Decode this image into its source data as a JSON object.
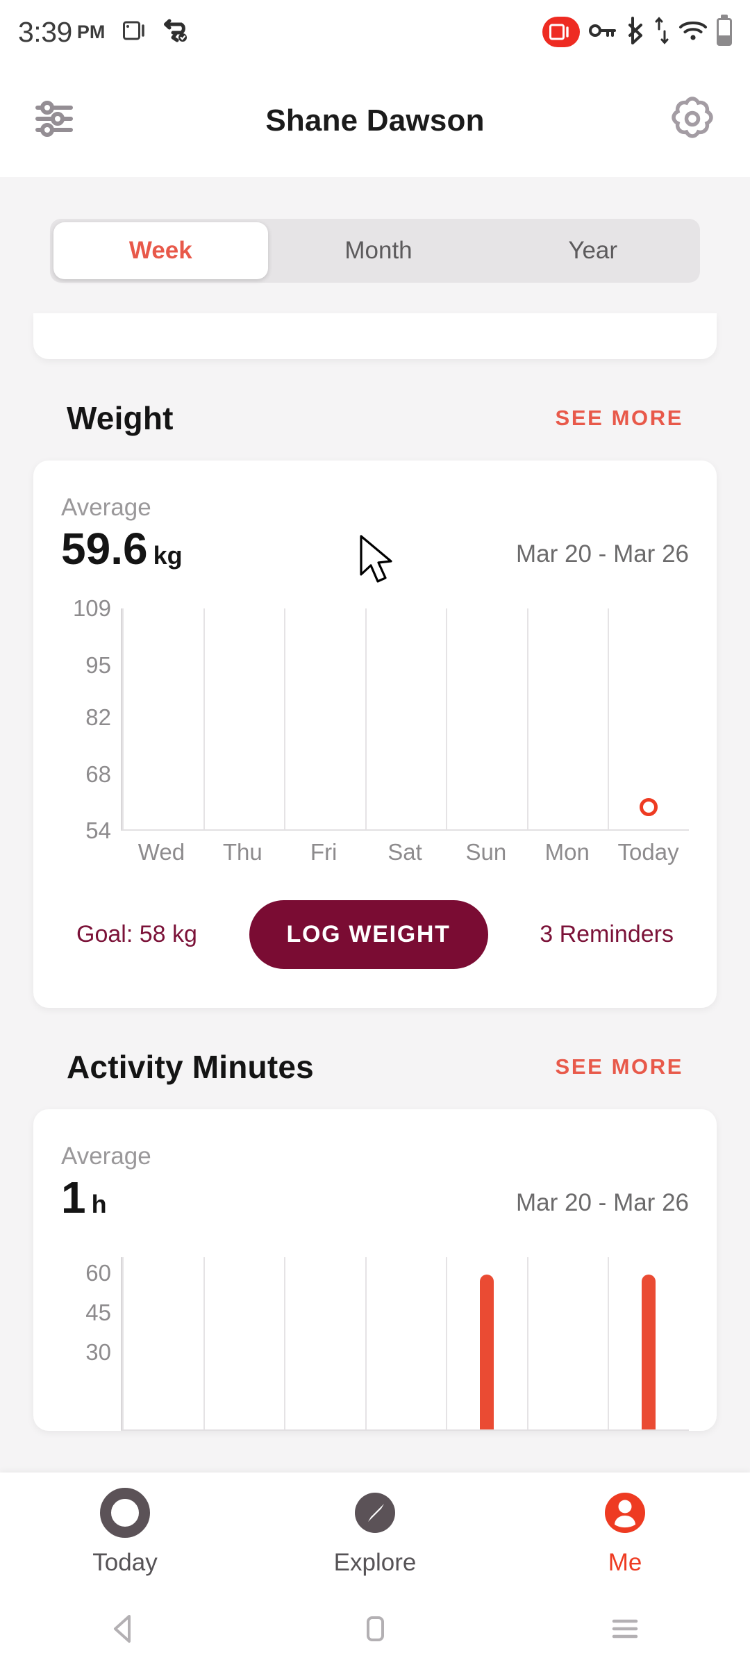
{
  "statusbar": {
    "time": "3:39",
    "ampm": "PM",
    "icons_left": [
      "screen-record-icon",
      "vpn-key-sync-icon"
    ],
    "icons_right": [
      "recording-badge-icon",
      "vpn-key-icon",
      "bluetooth-icon",
      "data-transfer-icon",
      "wifi-icon",
      "battery-icon"
    ],
    "accent_red": "#ee2b22"
  },
  "header": {
    "title": "Shane Dawson",
    "left_icon": "tune-sliders-icon",
    "right_icon": "settings-gear-icon"
  },
  "period_tabs": {
    "items": [
      {
        "label": "Week",
        "active": true
      },
      {
        "label": "Month",
        "active": false
      },
      {
        "label": "Year",
        "active": false
      }
    ],
    "active_color": "#e8594a"
  },
  "sections": [
    {
      "title": "Weight",
      "see_more": "SEE MORE",
      "average_label": "Average",
      "average_value": "59.6",
      "average_unit": "kg",
      "date_range": "Mar 20 - Mar 26",
      "footer": {
        "goal": "Goal: 58 kg",
        "button": "LOG WEIGHT",
        "reminders": "3 Reminders"
      }
    },
    {
      "title": "Activity Minutes",
      "see_more": "SEE MORE",
      "average_label": "Average",
      "average_value": "1",
      "average_unit": "h",
      "date_range": "Mar 20 - Mar 26"
    }
  ],
  "bottom_nav": {
    "items": [
      {
        "label": "Today",
        "icon": "ring-circle-icon",
        "active": false
      },
      {
        "label": "Explore",
        "icon": "compass-icon",
        "active": false
      },
      {
        "label": "Me",
        "icon": "person-icon",
        "active": true
      }
    ],
    "active_color": "#ee3b22"
  },
  "android_nav": {
    "buttons": [
      "back-triangle-icon",
      "home-square-icon",
      "recents-menu-icon"
    ]
  },
  "theme": {
    "accent_red": "#e8594a",
    "bar_red": "#ea4b33",
    "maroon": "#7a0c33",
    "page_bg": "#f5f4f5",
    "card_bg": "#ffffff"
  },
  "chart_data": [
    {
      "type": "scatter",
      "title": "Weight",
      "xlabel": "",
      "ylabel": "kg",
      "categories": [
        "Wed",
        "Thu",
        "Fri",
        "Sat",
        "Sun",
        "Mon",
        "Today"
      ],
      "values": [
        null,
        null,
        null,
        null,
        null,
        null,
        59.6
      ],
      "yticks": [
        109,
        95,
        82,
        68,
        54
      ],
      "ylim": [
        54,
        109
      ],
      "grid": true,
      "legend": "none",
      "marker": "hollow-circle",
      "marker_color": "#ee3b22",
      "annotations": [
        "Average 59.6 kg",
        "Mar 20 - Mar 26",
        "Goal: 58 kg"
      ]
    },
    {
      "type": "bar",
      "title": "Activity Minutes",
      "xlabel": "",
      "ylabel": "minutes",
      "categories": [
        "Wed",
        "Thu",
        "Fri",
        "Sat",
        "Sun",
        "Mon",
        "Today"
      ],
      "values": [
        0,
        0,
        0,
        0,
        59,
        0,
        59
      ],
      "yticks": [
        60,
        45,
        30
      ],
      "ylim": [
        0,
        66
      ],
      "grid": true,
      "legend": "none",
      "bar_color": "#ea4b33",
      "annotations": [
        "Average 1h",
        "Mar 20 - Mar 26"
      ]
    }
  ]
}
